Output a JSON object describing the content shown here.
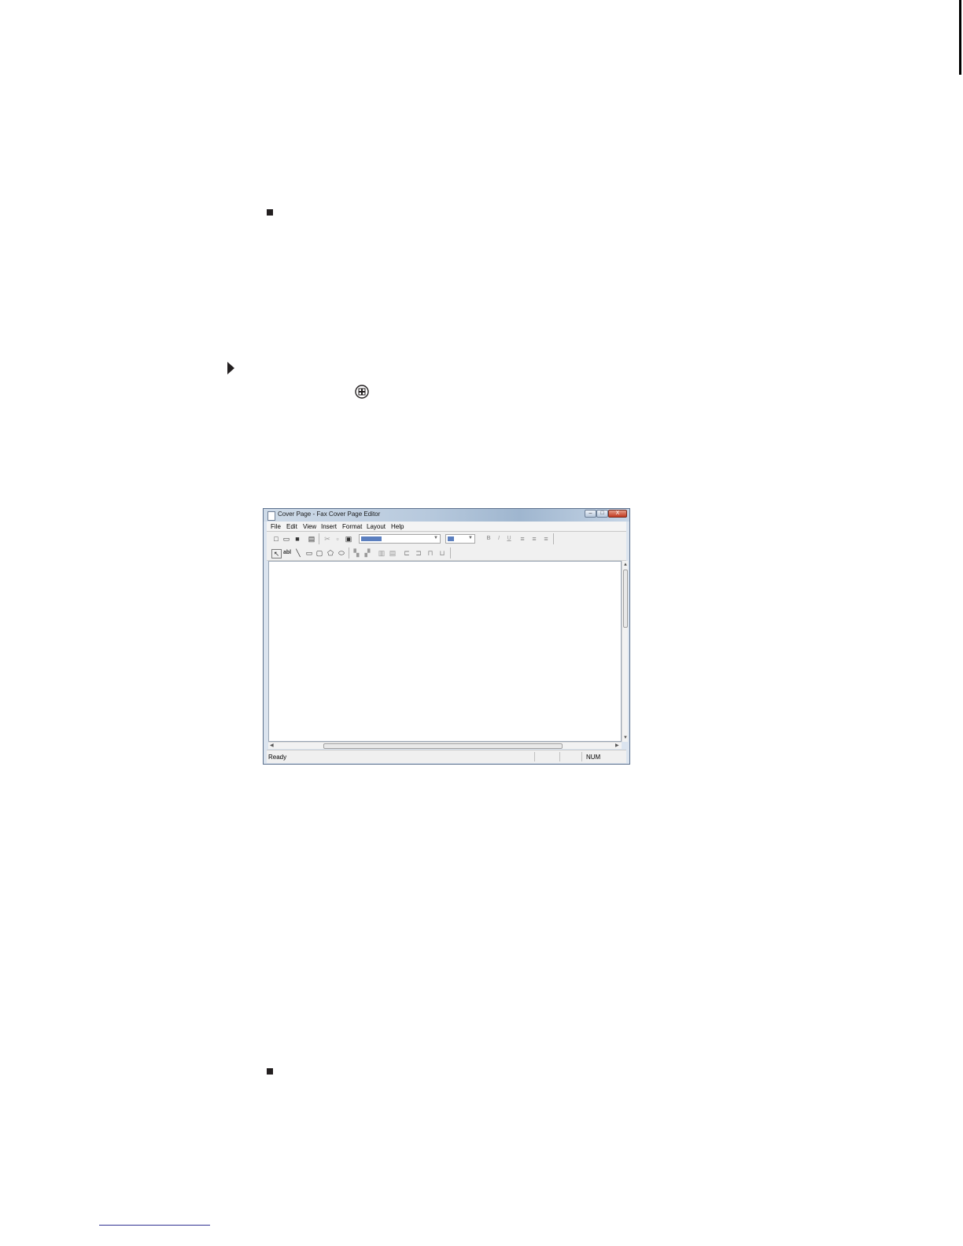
{
  "window": {
    "title": "Cover Page - Fax Cover Page Editor",
    "controls": {
      "minimize": "–",
      "maximize": "□",
      "close": "X"
    }
  },
  "menu": [
    "File",
    "Edit",
    "View",
    "Insert",
    "Format",
    "Layout",
    "Help"
  ],
  "toolbar1": {
    "icons": [
      "new-icon",
      "open-icon",
      "save-icon",
      "print-icon",
      "cut-icon",
      "copy-icon",
      "paste-icon",
      "bold-icon",
      "italic-icon",
      "underline-icon",
      "align-left-icon",
      "align-center-icon",
      "align-right-icon"
    ],
    "bold": "B",
    "italic": "I",
    "underline": "U"
  },
  "toolbar2": {
    "text_tool": "abl"
  },
  "status": {
    "text": "Ready",
    "num": "NUM"
  },
  "colors": {
    "accent": "#5b7fbf",
    "title_bar": "#b7c9dd",
    "close_button": "#c23a20"
  }
}
